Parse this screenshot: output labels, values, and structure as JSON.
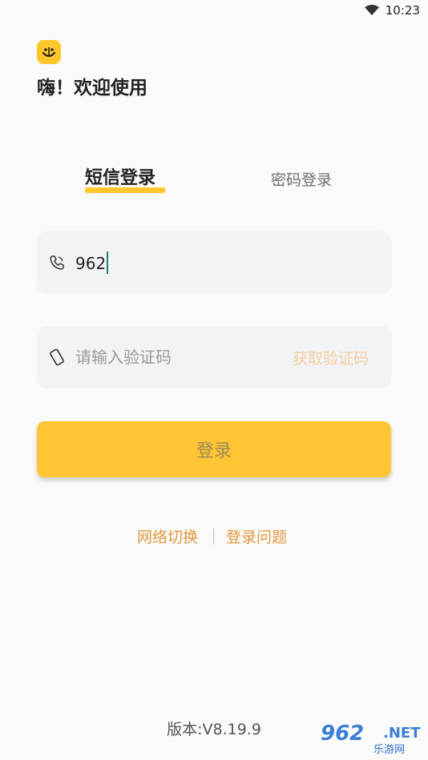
{
  "status_bar": {
    "time": "10:23",
    "wifi_icon": "wifi-icon"
  },
  "header": {
    "logo_icon": "smiley-logo-icon",
    "welcome": "嗨！欢迎使用"
  },
  "tabs": {
    "sms_login": "短信登录",
    "password_login": "密码登录",
    "active": "sms_login"
  },
  "phone_field": {
    "value": "962",
    "icon": "phone-icon"
  },
  "code_field": {
    "placeholder": "请输入验证码",
    "value": "",
    "icon": "device-icon",
    "get_code": "获取验证码"
  },
  "login_button": {
    "label": "登录"
  },
  "links": {
    "network_switch": "网络切换",
    "login_problem": "登录问题"
  },
  "footer": {
    "version": "版本:V8.19.9"
  },
  "watermark": {
    "main": "962",
    "net": ".NET",
    "sub": "乐游网"
  },
  "colors": {
    "accent": "#ffc72c",
    "link": "#e2973b",
    "get_code": "#f5cfa0"
  }
}
